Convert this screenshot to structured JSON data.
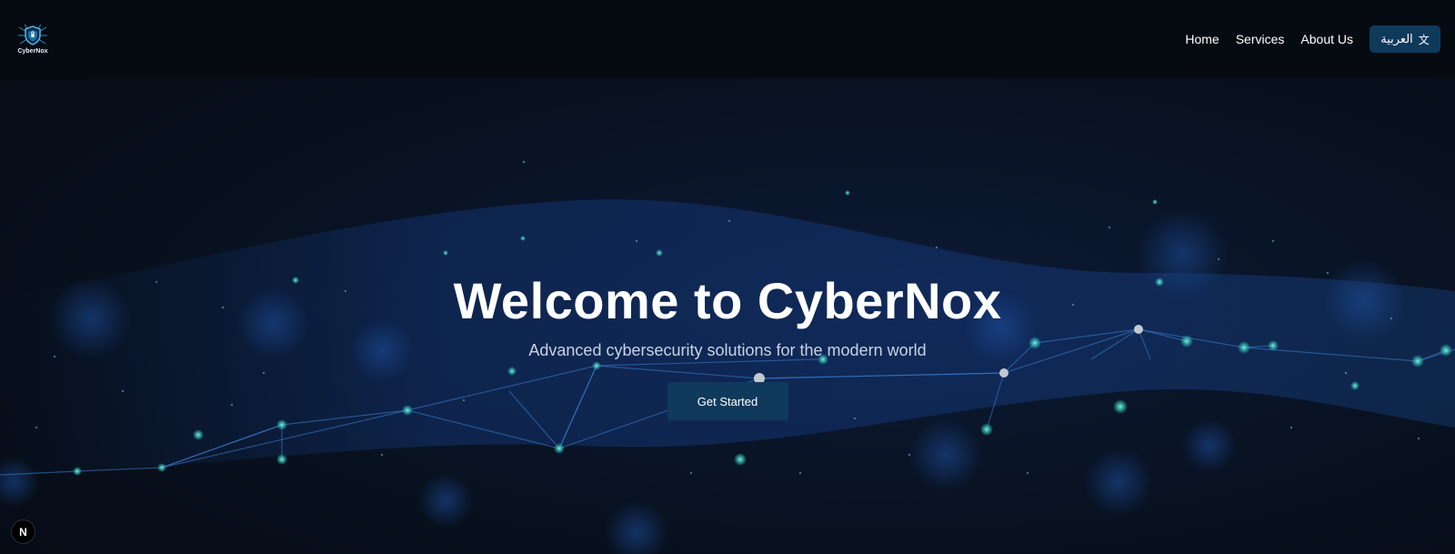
{
  "navbar": {
    "logo_text": "CyberNox",
    "logo_icon": "shield-icon",
    "links": [
      {
        "label": "Home"
      },
      {
        "label": "Services"
      },
      {
        "label": "About Us"
      }
    ],
    "language_button": {
      "label": "العربية",
      "icon": "translate-icon"
    }
  },
  "hero": {
    "title": "Welcome to CyberNox",
    "subtitle": "Advanced cybersecurity solutions for the modern world",
    "cta_label": "Get Started"
  },
  "dev_badge": {
    "label": "N"
  },
  "colors": {
    "background": "#07101a",
    "navbar": "#060b11",
    "accent_button": "#0f3a5c",
    "network_glow": "#3fd6c0",
    "network_line": "#3b7fd0"
  }
}
